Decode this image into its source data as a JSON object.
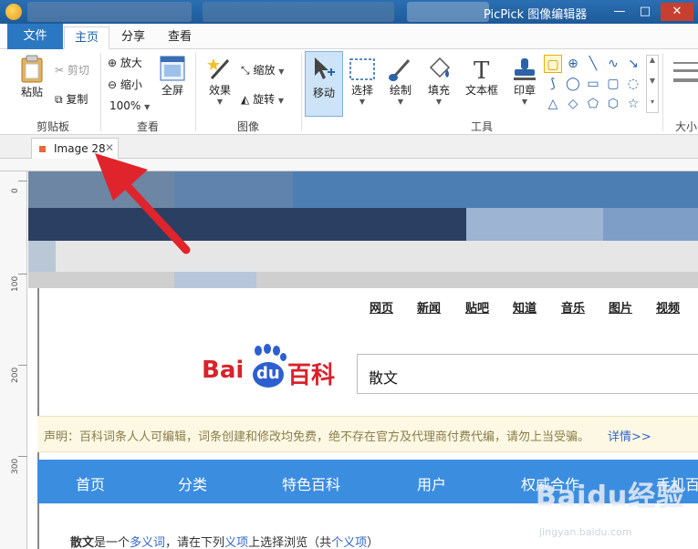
{
  "window": {
    "title": "PicPick 图像编辑器",
    "controls": [
      "—",
      "□",
      "✕"
    ]
  },
  "menu": {
    "file": "文件",
    "home": "主页",
    "share": "分享",
    "view": "查看"
  },
  "ribbon": {
    "clipboard": {
      "label": "剪贴板",
      "paste": "粘贴",
      "cut": "剪切",
      "copy": "复制"
    },
    "view": {
      "label": "查看",
      "zoom_in": "放大",
      "zoom_out": "缩小",
      "zoom_level": "100%",
      "fullscreen": "全屏"
    },
    "image": {
      "label": "图像",
      "effects": "效果",
      "resize": "缩放",
      "rotate": "旋转"
    },
    "tools": {
      "label": "工具",
      "move": "移动",
      "select": "选择",
      "draw": "绘制",
      "fill": "填充",
      "textbox": "文本框",
      "stamp": "印章"
    },
    "size_label": "大小"
  },
  "document_tab": {
    "name": "Image 28",
    "close": "✕"
  },
  "ruler": {
    "marks": [
      "0",
      "100",
      "200",
      "300"
    ]
  },
  "canvas": {
    "nav_links": [
      "网页",
      "新闻",
      "贴吧",
      "知道",
      "音乐",
      "图片",
      "视频"
    ],
    "logo": {
      "bai": "Bai",
      "du": "du",
      "name": "百科"
    },
    "search_value": "散文",
    "notice": "声明：百科词条人人可编辑，词条创建和修改均免费，绝不存在官方及代理商付费代编，请勿上当受骗。",
    "notice_link": "详情>>",
    "blue_nav": [
      "首页",
      "分类",
      "特色百科",
      "用户",
      "权威合作",
      "手机百"
    ],
    "bottom": {
      "term": "散文",
      "text1": "是一个",
      "link1": "多义词",
      "text2": "，请在下列",
      "link2": "义项",
      "text3": "上选择浏览（",
      "count": "共",
      "link3": "个义项",
      "text4": "）"
    }
  },
  "watermark": {
    "main": "Baidu经验",
    "sub": "jingyan.baidu.com"
  },
  "colors": {
    "accent": "#2b78c2",
    "arrow": "#e0242c",
    "baidu_red": "#d9222a",
    "baidu_blue": "#2d5fd0",
    "nav_blue": "#3b8de0"
  }
}
